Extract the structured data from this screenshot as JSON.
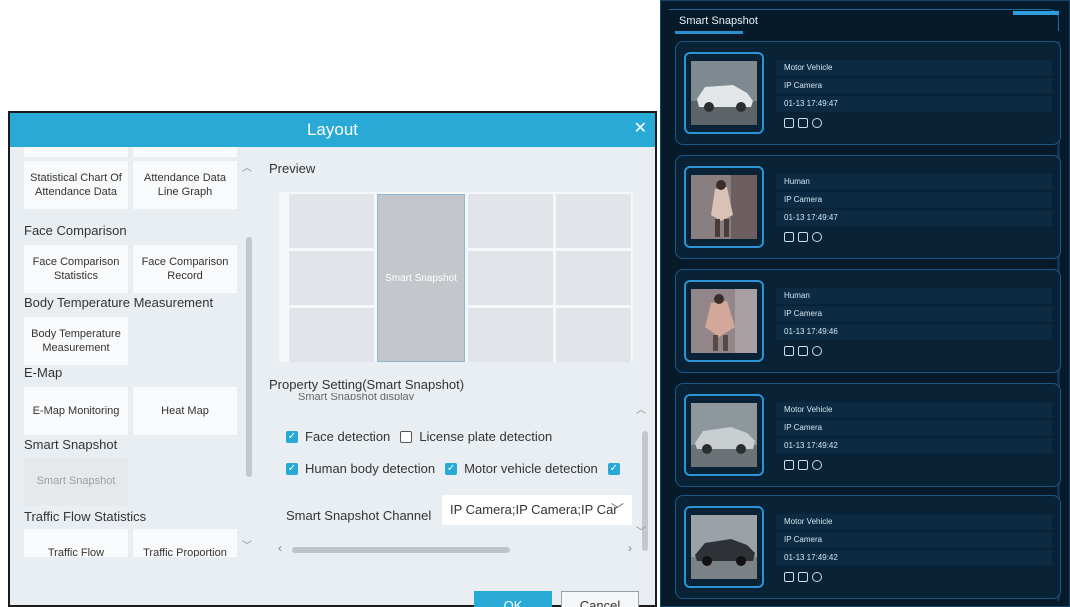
{
  "dialog": {
    "title": "Layout",
    "close_icon": "close-icon",
    "tiles": [
      {
        "label": "Statistical Chart Of Attendance Data"
      },
      {
        "label": "Attendance Data Line Graph"
      },
      {
        "label": "Face Comparison Statistics"
      },
      {
        "label": "Face Comparison Record"
      },
      {
        "label": "Body Temperature Measurement"
      },
      {
        "label": "E-Map Monitoring"
      },
      {
        "label": "Heat Map"
      },
      {
        "label": "Smart Snapshot"
      },
      {
        "label": "Traffic Flow"
      },
      {
        "label": "Traffic Proportion"
      }
    ],
    "categories": [
      "Face Comparison",
      "Body Temperature Measurement",
      "E-Map",
      "Smart Snapshot",
      "Traffic Flow Statistics"
    ],
    "preview_label": "Preview",
    "preview_cell_label": "Smart Snapshot",
    "property_label": "Property Setting(Smart Snapshot)",
    "property_cut_text": "Smart Snapshot display",
    "checkboxes": [
      {
        "label": "Face detection",
        "checked": true
      },
      {
        "label": "License plate detection",
        "checked": false
      },
      {
        "label": "Human body detection",
        "checked": true
      },
      {
        "label": "Motor vehicle detection",
        "checked": true
      }
    ],
    "channel_label": "Smart Snapshot Channel",
    "channel_value": "IP Camera;IP Camera;IP Car",
    "ok_label": "OK",
    "cancel_label": "Cancel"
  },
  "panel": {
    "title": "Smart Snapshot",
    "cards": [
      {
        "type": "Motor Vehicle",
        "camera": "IP Camera",
        "time": "01-13 17:49:47"
      },
      {
        "type": "Human",
        "camera": "IP Camera",
        "time": "01-13 17:49:47"
      },
      {
        "type": "Human",
        "camera": "IP Camera",
        "time": "01-13 17:49:46"
      },
      {
        "type": "Motor Vehicle",
        "camera": "IP Camera",
        "time": "01-13 17:49:42"
      },
      {
        "type": "Motor Vehicle",
        "camera": "IP Camera",
        "time": "01-13 17:49:42"
      }
    ]
  },
  "colors": {
    "accent": "#28a9d6",
    "panel_bg": "#071a2a",
    "panel_border": "#1a5a84"
  }
}
